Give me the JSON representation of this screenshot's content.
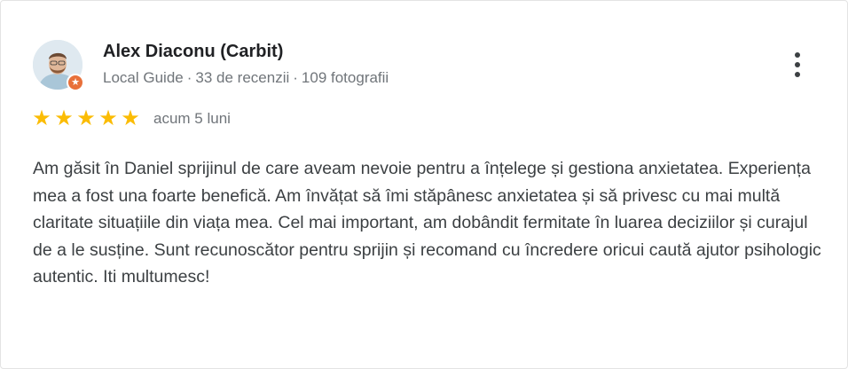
{
  "review": {
    "author": {
      "name": "Alex Diaconu (Carbit)",
      "level": "Local Guide",
      "separator": "·",
      "reviews_count": "33 de recenzii",
      "photos_count": "109 fotografii",
      "badge_icon": "star-icon"
    },
    "rating": {
      "value": 5,
      "max": 5,
      "star_glyph": "★",
      "color": "#fbbc04"
    },
    "date": "acum 5 luni",
    "text": "Am găsit în Daniel sprijinul de care aveam nevoie pentru a înțelege și gestiona anxietatea. Experiența mea a fost una foarte benefică. Am învățat să îmi stăpânesc anxietatea și să privesc cu mai multă claritate situațiile din viața mea. Cel mai important, am dobândit fermitate în luarea deciziilor și curajul de a le susține. Sunt recunoscător pentru sprijin și recomand cu încredere oricui caută ajutor psihologic autentic. Iti multumesc!",
    "more_icon": "more-vert-icon",
    "badge_color": "#e8703a"
  }
}
